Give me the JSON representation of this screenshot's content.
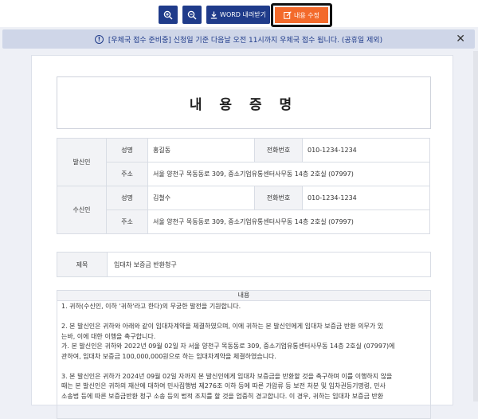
{
  "toolbar": {
    "word_label": "WORD 내려받기",
    "edit_label": "내용 수정"
  },
  "notice": {
    "text": "[우체국 접수 준비중] 신청일 기준 다음날 오전 11시까지 우체국 접수 됩니다. (공휴일 제외)"
  },
  "document": {
    "title": "내 용 증 명",
    "sender": {
      "section": "발신인",
      "name_label": "성명",
      "name": "홍길동",
      "phone_label": "전화번호",
      "phone": "010-1234-1234",
      "address_label": "주소",
      "address": "서울 양천구 목동동로 309, 중소기업유통센터사무동 14층 2호실 (07997)"
    },
    "recipient": {
      "section": "수신인",
      "name_label": "성명",
      "name": "김철수",
      "phone_label": "전화번호",
      "phone": "010-1234-1234",
      "address_label": "주소",
      "address": "서울 양천구 목동동로 309, 중소기업유통센터사무동 14층 2호실 (07997)"
    },
    "subject_label": "제목",
    "subject": "임대차 보증금 반환청구",
    "content_label": "내용",
    "content_lines": [
      "1. 귀하(수신인, 이하 '귀하'라고 한다)의 무궁한 발전을 기원합니다.",
      "",
      "2. 본 발신인은 귀하와 아래와 같이 임대차계약을 체결하였으며, 이에 귀하는 본 발신인에게 임대차 보증금 반환 의무가 있",
      "는바, 이에 대한 이행을 촉구합니다.",
      "   가. 본 발신인은 귀하와 2022년 09월 02일 자 서울 양천구 목동동로 309, 중소기업유통센터사무동 14층 2호실 (07997)에",
      "관하여, 임대차 보증금 100,000,000원으로 하는 임대차계약을 체결하였습니다.",
      "",
      "3. 본 발신인은 귀하가 2024년 09월 02일 자까지 본 발신인에게 임대차 보증금을 반환할 것을 촉구하며 이를 이행하지 않을",
      "때는 본 발신인은 귀하의 재산에 대하여 민사집행법 제276조 이하 등에 따른 가압류 등 보전 처분 및 임차권등기명령, 민사",
      "소송법 등에 따른 보증금반환 청구 소송 등의 법적 조치를 할 것을 엄중히 경고합니다. 이 경우, 귀하는 임대차 보증금 반환"
    ]
  }
}
